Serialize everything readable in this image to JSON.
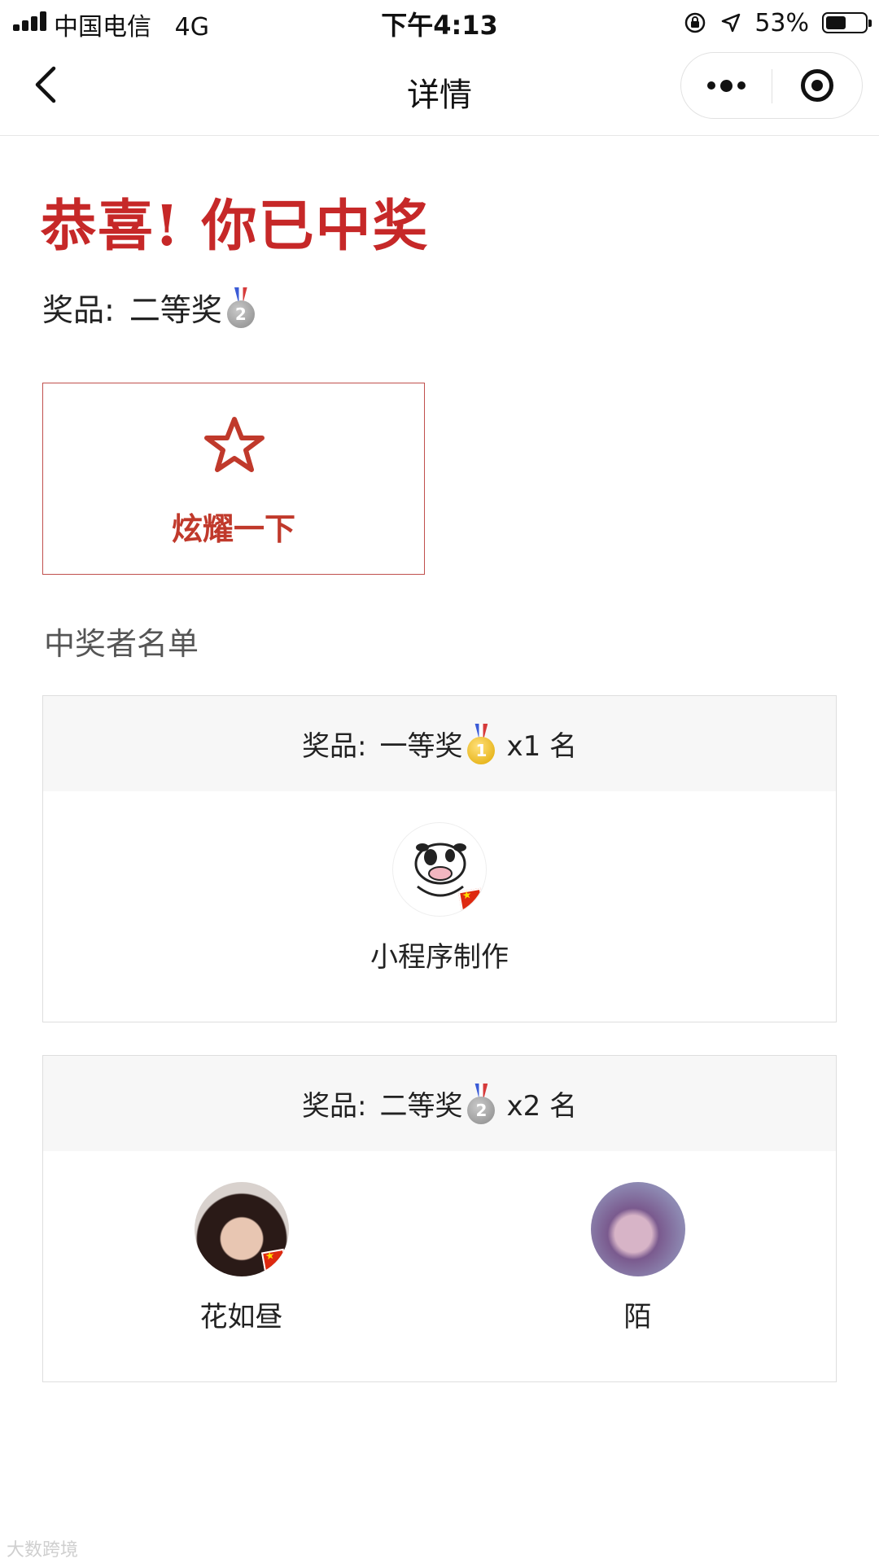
{
  "status_bar": {
    "carrier": "中国电信",
    "network": "4G",
    "time": "下午4:13",
    "battery_percent": "53%",
    "battery_level": 0.53
  },
  "nav": {
    "title": "详情"
  },
  "headline": "恭喜! 你已中奖",
  "my_prize": {
    "label": "奖品:",
    "name": "二等奖",
    "medal": "2"
  },
  "show_off": {
    "label": "炫耀一下"
  },
  "winners_section": {
    "title": "中奖者名单"
  },
  "prize_groups": [
    {
      "label": "奖品:",
      "name": "一等奖",
      "medal": "1",
      "count": "x1 名",
      "winners": [
        {
          "name": "小程序制作"
        }
      ]
    },
    {
      "label": "奖品:",
      "name": "二等奖",
      "medal": "2",
      "count": "x2 名",
      "winners": [
        {
          "name": "花如昼"
        },
        {
          "name": "陌"
        }
      ]
    }
  ],
  "watermark": "大数跨境",
  "colors": {
    "accent": "#c62828",
    "card_border": "#c0504d",
    "header_bg": "#f7f7f7"
  }
}
